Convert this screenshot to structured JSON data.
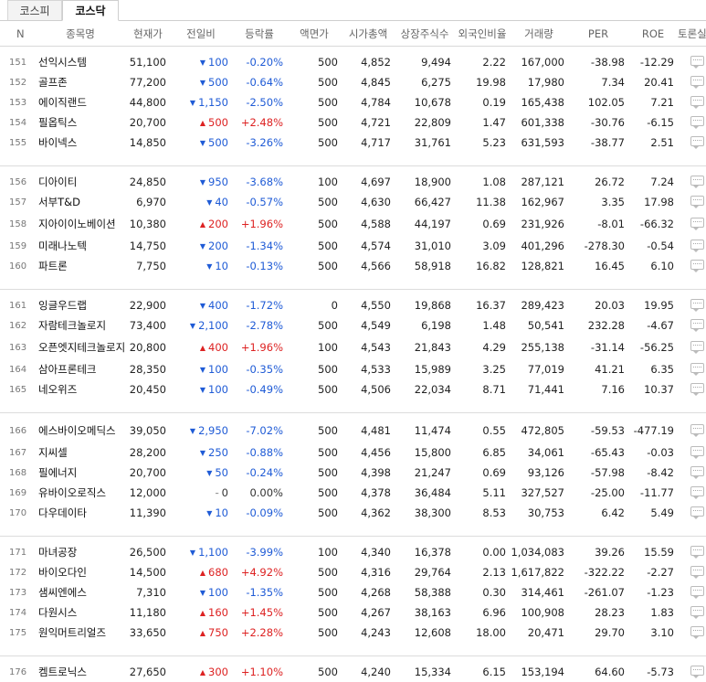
{
  "tabs": [
    "코스피",
    "코스닥"
  ],
  "headers": [
    "N",
    "종목명",
    "현재가",
    "전일비",
    "등락률",
    "액면가",
    "시가총액",
    "상장주식수",
    "외국인비율",
    "거래량",
    "PER",
    "ROE",
    "토론실"
  ],
  "groups": [
    [
      {
        "n": "151",
        "name": "선익시스템",
        "price": "51,100",
        "dir": "down",
        "diff": "100",
        "rate": "-0.20%",
        "face": "500",
        "cap": "4,852",
        "shares": "9,494",
        "foreign": "2.22",
        "vol": "167,000",
        "per": "-38.98",
        "roe": "-12.29"
      },
      {
        "n": "152",
        "name": "골프존",
        "price": "77,200",
        "dir": "down",
        "diff": "500",
        "rate": "-0.64%",
        "face": "500",
        "cap": "4,845",
        "shares": "6,275",
        "foreign": "19.98",
        "vol": "17,980",
        "per": "7.34",
        "roe": "20.41"
      },
      {
        "n": "153",
        "name": "에이직랜드",
        "price": "44,800",
        "dir": "down",
        "diff": "1,150",
        "rate": "-2.50%",
        "face": "500",
        "cap": "4,784",
        "shares": "10,678",
        "foreign": "0.19",
        "vol": "165,438",
        "per": "102.05",
        "roe": "7.21"
      },
      {
        "n": "154",
        "name": "필옵틱스",
        "price": "20,700",
        "dir": "up",
        "diff": "500",
        "rate": "+2.48%",
        "face": "500",
        "cap": "4,721",
        "shares": "22,809",
        "foreign": "1.47",
        "vol": "601,338",
        "per": "-30.76",
        "roe": "-6.15"
      },
      {
        "n": "155",
        "name": "바이넥스",
        "price": "14,850",
        "dir": "down",
        "diff": "500",
        "rate": "-3.26%",
        "face": "500",
        "cap": "4,717",
        "shares": "31,761",
        "foreign": "5.23",
        "vol": "631,593",
        "per": "-38.77",
        "roe": "2.51"
      }
    ],
    [
      {
        "n": "156",
        "name": "디아이티",
        "price": "24,850",
        "dir": "down",
        "diff": "950",
        "rate": "-3.68%",
        "face": "100",
        "cap": "4,697",
        "shares": "18,900",
        "foreign": "1.08",
        "vol": "287,121",
        "per": "26.72",
        "roe": "7.24"
      },
      {
        "n": "157",
        "name": "서부T&D",
        "price": "6,970",
        "dir": "down",
        "diff": "40",
        "rate": "-0.57%",
        "face": "500",
        "cap": "4,630",
        "shares": "66,427",
        "foreign": "11.38",
        "vol": "162,967",
        "per": "3.35",
        "roe": "17.98"
      },
      {
        "n": "158",
        "name": "지아이이노베이션",
        "price": "10,380",
        "dir": "up",
        "diff": "200",
        "rate": "+1.96%",
        "face": "500",
        "cap": "4,588",
        "shares": "44,197",
        "foreign": "0.69",
        "vol": "231,926",
        "per": "-8.01",
        "roe": "-66.32"
      },
      {
        "n": "159",
        "name": "미래나노텍",
        "price": "14,750",
        "dir": "down",
        "diff": "200",
        "rate": "-1.34%",
        "face": "500",
        "cap": "4,574",
        "shares": "31,010",
        "foreign": "3.09",
        "vol": "401,296",
        "per": "-278.30",
        "roe": "-0.54"
      },
      {
        "n": "160",
        "name": "파트론",
        "price": "7,750",
        "dir": "down",
        "diff": "10",
        "rate": "-0.13%",
        "face": "500",
        "cap": "4,566",
        "shares": "58,918",
        "foreign": "16.82",
        "vol": "128,821",
        "per": "16.45",
        "roe": "6.10"
      }
    ],
    [
      {
        "n": "161",
        "name": "잉글우드랩",
        "price": "22,900",
        "dir": "down",
        "diff": "400",
        "rate": "-1.72%",
        "face": "0",
        "cap": "4,550",
        "shares": "19,868",
        "foreign": "16.37",
        "vol": "289,423",
        "per": "20.03",
        "roe": "19.95"
      },
      {
        "n": "162",
        "name": "자람테크놀로지",
        "price": "73,400",
        "dir": "down",
        "diff": "2,100",
        "rate": "-2.78%",
        "face": "500",
        "cap": "4,549",
        "shares": "6,198",
        "foreign": "1.48",
        "vol": "50,541",
        "per": "232.28",
        "roe": "-4.67"
      },
      {
        "n": "163",
        "name": "오픈엣지테크놀로지",
        "price": "20,800",
        "dir": "up",
        "diff": "400",
        "rate": "+1.96%",
        "face": "100",
        "cap": "4,543",
        "shares": "21,843",
        "foreign": "4.29",
        "vol": "255,138",
        "per": "-31.14",
        "roe": "-56.25"
      },
      {
        "n": "164",
        "name": "삼아프론테크",
        "price": "28,350",
        "dir": "down",
        "diff": "100",
        "rate": "-0.35%",
        "face": "500",
        "cap": "4,533",
        "shares": "15,989",
        "foreign": "3.25",
        "vol": "77,019",
        "per": "41.21",
        "roe": "6.35"
      },
      {
        "n": "165",
        "name": "네오위즈",
        "price": "20,450",
        "dir": "down",
        "diff": "100",
        "rate": "-0.49%",
        "face": "500",
        "cap": "4,506",
        "shares": "22,034",
        "foreign": "8.71",
        "vol": "71,441",
        "per": "7.16",
        "roe": "10.37"
      }
    ],
    [
      {
        "n": "166",
        "name": "에스바이오메딕스",
        "price": "39,050",
        "dir": "down",
        "diff": "2,950",
        "rate": "-7.02%",
        "face": "500",
        "cap": "4,481",
        "shares": "11,474",
        "foreign": "0.55",
        "vol": "472,805",
        "per": "-59.53",
        "roe": "-477.19"
      },
      {
        "n": "167",
        "name": "지씨셀",
        "price": "28,200",
        "dir": "down",
        "diff": "250",
        "rate": "-0.88%",
        "face": "500",
        "cap": "4,456",
        "shares": "15,800",
        "foreign": "6.85",
        "vol": "34,061",
        "per": "-65.43",
        "roe": "-0.03"
      },
      {
        "n": "168",
        "name": "필에너지",
        "price": "20,700",
        "dir": "down",
        "diff": "50",
        "rate": "-0.24%",
        "face": "500",
        "cap": "4,398",
        "shares": "21,247",
        "foreign": "0.69",
        "vol": "93,126",
        "per": "-57.98",
        "roe": "-8.42"
      },
      {
        "n": "169",
        "name": "유바이오로직스",
        "price": "12,000",
        "dir": "flat",
        "diff": "0",
        "rate": "0.00%",
        "face": "500",
        "cap": "4,378",
        "shares": "36,484",
        "foreign": "5.11",
        "vol": "327,527",
        "per": "-25.00",
        "roe": "-11.77"
      },
      {
        "n": "170",
        "name": "다우데이타",
        "price": "11,390",
        "dir": "down",
        "diff": "10",
        "rate": "-0.09%",
        "face": "500",
        "cap": "4,362",
        "shares": "38,300",
        "foreign": "8.53",
        "vol": "30,753",
        "per": "6.42",
        "roe": "5.49"
      }
    ],
    [
      {
        "n": "171",
        "name": "마녀공장",
        "price": "26,500",
        "dir": "down",
        "diff": "1,100",
        "rate": "-3.99%",
        "face": "100",
        "cap": "4,340",
        "shares": "16,378",
        "foreign": "0.00",
        "vol": "1,034,083",
        "per": "39.26",
        "roe": "15.59"
      },
      {
        "n": "172",
        "name": "바이오다인",
        "price": "14,500",
        "dir": "up",
        "diff": "680",
        "rate": "+4.92%",
        "face": "500",
        "cap": "4,316",
        "shares": "29,764",
        "foreign": "2.13",
        "vol": "1,617,822",
        "per": "-322.22",
        "roe": "-2.27"
      },
      {
        "n": "173",
        "name": "샘씨엔에스",
        "price": "7,310",
        "dir": "down",
        "diff": "100",
        "rate": "-1.35%",
        "face": "500",
        "cap": "4,268",
        "shares": "58,388",
        "foreign": "0.30",
        "vol": "314,461",
        "per": "-261.07",
        "roe": "-1.23"
      },
      {
        "n": "174",
        "name": "다원시스",
        "price": "11,180",
        "dir": "up",
        "diff": "160",
        "rate": "+1.45%",
        "face": "500",
        "cap": "4,267",
        "shares": "38,163",
        "foreign": "6.96",
        "vol": "100,908",
        "per": "28.23",
        "roe": "1.83"
      },
      {
        "n": "175",
        "name": "원익머트리얼즈",
        "price": "33,650",
        "dir": "up",
        "diff": "750",
        "rate": "+2.28%",
        "face": "500",
        "cap": "4,243",
        "shares": "12,608",
        "foreign": "18.00",
        "vol": "20,471",
        "per": "29.70",
        "roe": "3.10"
      }
    ],
    [
      {
        "n": "176",
        "name": "켐트로닉스",
        "price": "27,650",
        "dir": "up",
        "diff": "300",
        "rate": "+1.10%",
        "face": "500",
        "cap": "4,240",
        "shares": "15,334",
        "foreign": "6.15",
        "vol": "153,194",
        "per": "64.60",
        "roe": "-5.73"
      }
    ]
  ],
  "icons": {
    "up": "▲",
    "down": "▼",
    "flat": "–",
    "discussion": "chat-bubble-icon"
  },
  "colors": {
    "up": "#d22222",
    "down": "#1f5bd6",
    "flat": "#333333"
  }
}
